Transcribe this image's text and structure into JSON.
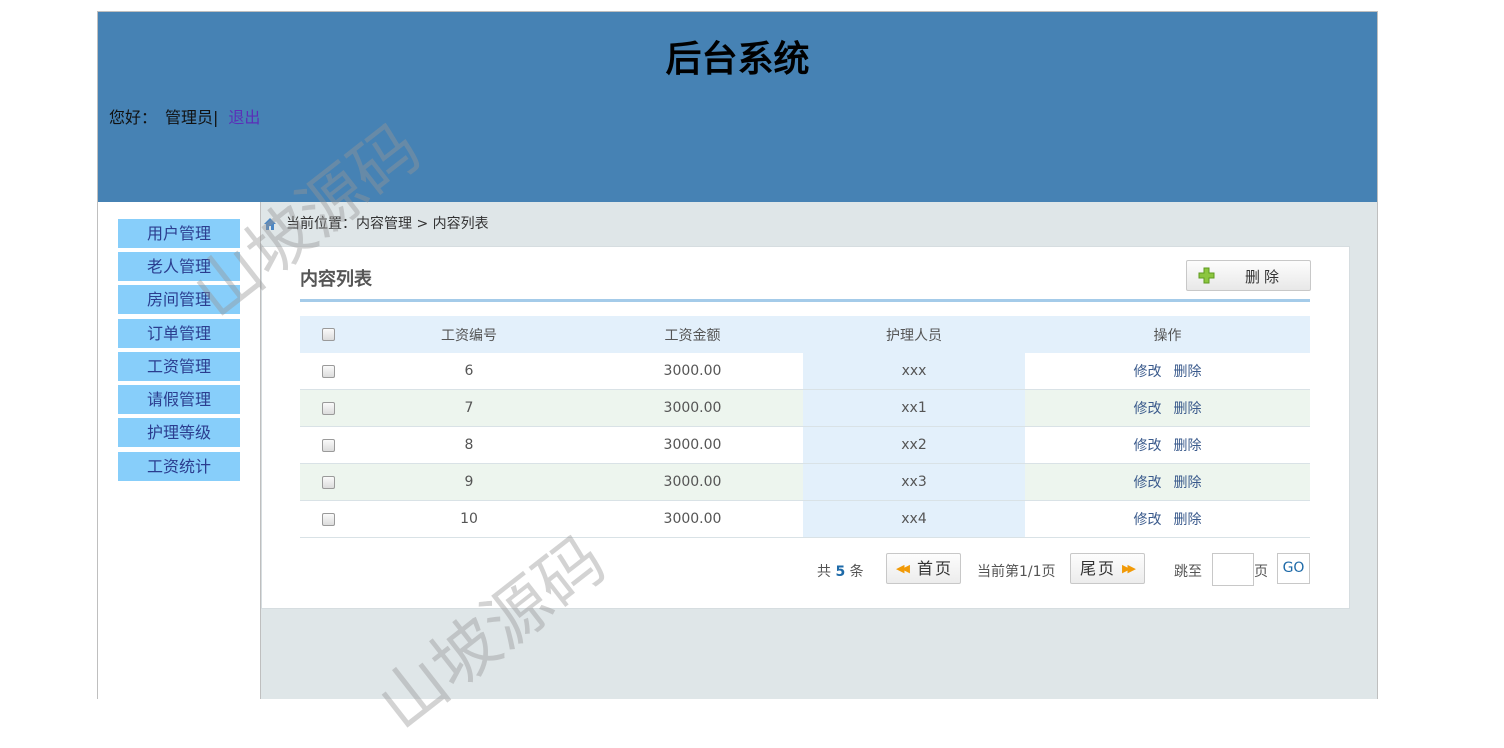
{
  "header": {
    "title": "后台系统",
    "greeting": "您好：",
    "username": "管理员|",
    "logout": "退出"
  },
  "sidebar": {
    "items": [
      {
        "label": "用户管理"
      },
      {
        "label": "老人管理"
      },
      {
        "label": "房间管理"
      },
      {
        "label": "订单管理"
      },
      {
        "label": "工资管理"
      },
      {
        "label": "请假管理"
      },
      {
        "label": "护理等级"
      },
      {
        "label": "工资统计"
      }
    ]
  },
  "breadcrumb": "当前位置：内容管理 > 内容列表",
  "panel": {
    "title": "内容列表",
    "delete_button": "删除"
  },
  "table": {
    "columns": [
      "工资编号",
      "工资金额",
      "护理人员",
      "操作"
    ],
    "rows": [
      {
        "id": "6",
        "amount": "3000.00",
        "nurse": "xxx",
        "edit": "修改",
        "delete": "删除"
      },
      {
        "id": "7",
        "amount": "3000.00",
        "nurse": "xx1",
        "edit": "修改",
        "delete": "删除"
      },
      {
        "id": "8",
        "amount": "3000.00",
        "nurse": "xx2",
        "edit": "修改",
        "delete": "删除"
      },
      {
        "id": "9",
        "amount": "3000.00",
        "nurse": "xx3",
        "edit": "修改",
        "delete": "删除"
      },
      {
        "id": "10",
        "amount": "3000.00",
        "nurse": "xx4",
        "edit": "修改",
        "delete": "删除"
      }
    ]
  },
  "pager": {
    "total_prefix": "共",
    "total_count": "5",
    "total_suffix": "条",
    "first": "首页",
    "current": "当前第1/1页",
    "last": "尾页",
    "jump": "跳至",
    "page_unit": "页",
    "go": "GO"
  },
  "watermark": "山坡源码",
  "colors": {
    "header_bg": "#4682b4",
    "menu_bg": "#87cefa",
    "content_bg": "#dfe6e8",
    "table_header_bg": "#e3f0fb",
    "alt_row_bg": "#edf5ee"
  }
}
